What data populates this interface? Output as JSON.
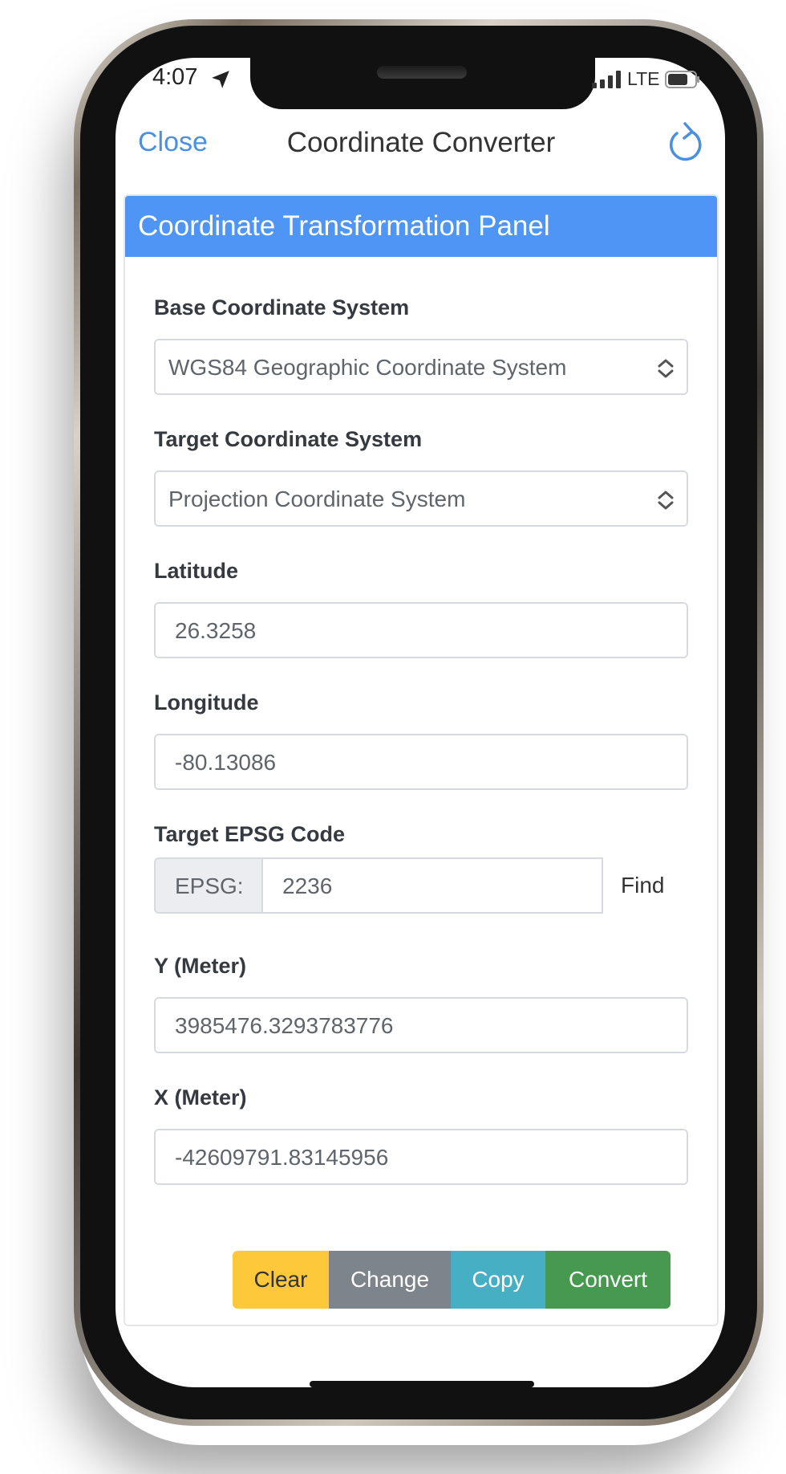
{
  "status_bar": {
    "time": "4:07",
    "network": "LTE",
    "icons": [
      "location-arrow-icon",
      "signal-bars-icon",
      "battery-icon"
    ]
  },
  "nav": {
    "close_label": "Close",
    "title": "Coordinate Converter",
    "refresh_icon": "refresh-icon"
  },
  "panel": {
    "title": "Coordinate Transformation Panel",
    "header_color": "#4f95f5"
  },
  "form": {
    "base_system": {
      "label": "Base Coordinate System",
      "selected": "WGS84 Geographic Coordinate System"
    },
    "target_system": {
      "label": "Target Coordinate System",
      "selected": "Projection Coordinate System"
    },
    "latitude": {
      "label": "Latitude",
      "value": "26.3258"
    },
    "longitude": {
      "label": "Longitude",
      "value": "-80.13086"
    },
    "epsg": {
      "label": "Target EPSG Code",
      "prefix": "EPSG:",
      "value": "2236",
      "find_label": "Find"
    },
    "y_meter": {
      "label": "Y (Meter)",
      "value": "3985476.3293783776"
    },
    "x_meter": {
      "label": "X (Meter)",
      "value": "-42609791.83145956"
    }
  },
  "actions": {
    "clear": {
      "label": "Clear",
      "color": "#fdc83a"
    },
    "change": {
      "label": "Change",
      "color": "#7e848c"
    },
    "copy": {
      "label": "Copy",
      "color": "#47afc4"
    },
    "convert": {
      "label": "Convert",
      "color": "#47994f"
    }
  },
  "accent_color": "#4a90e2"
}
